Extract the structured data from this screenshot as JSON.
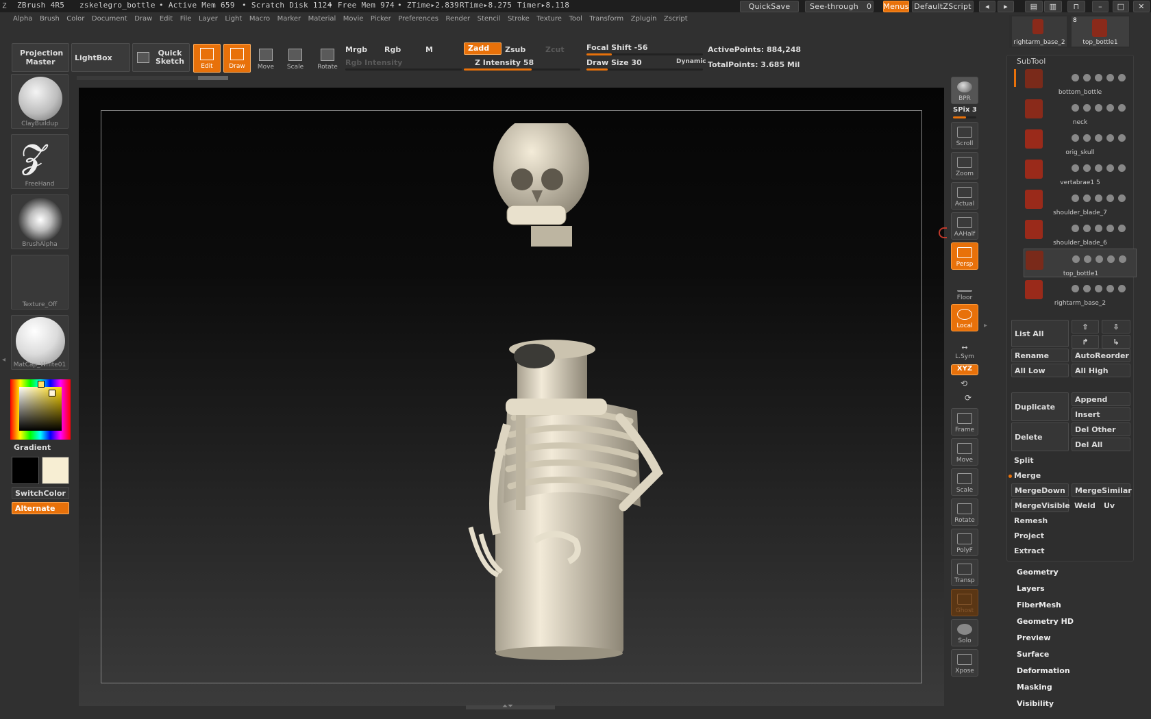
{
  "titlebar": {
    "app": "ZBrush 4R5",
    "document": "zskelegro_bottle",
    "active_mem": "• Active Mem 659",
    "scratch_disk": "• Scratch Disk 1124",
    "free_mem": "• Free Mem 974",
    "ztime": "• ZTime▸2.839",
    "rtime": "RTime▸8.275",
    "timer": "Timer▸8.118",
    "quicksave": "QuickSave",
    "see_through": "See-through",
    "see_through_value": "0",
    "menus": "Menus",
    "default_zscript": "DefaultZScript"
  },
  "menubar": [
    "Alpha",
    "Brush",
    "Color",
    "Document",
    "Draw",
    "Edit",
    "File",
    "Layer",
    "Light",
    "Macro",
    "Marker",
    "Material",
    "Movie",
    "Picker",
    "Preferences",
    "Render",
    "Stencil",
    "Stroke",
    "Texture",
    "Tool",
    "Transform",
    "Zplugin",
    "Zscript"
  ],
  "toolbar": {
    "projection_master": "Projection Master",
    "lightbox": "LightBox",
    "quick_sketch": "Quick Sketch",
    "edit": "Edit",
    "draw": "Draw",
    "move": "Move",
    "scale": "Scale",
    "rotate": "Rotate",
    "mrgb": "Mrgb",
    "rgb": "Rgb",
    "m": "M",
    "rgb_intensity": "Rgb Intensity",
    "zadd": "Zadd",
    "zsub": "Zsub",
    "zcut": "Zcut",
    "z_intensity": "Z Intensity 58",
    "focal_shift": "Focal Shift -56",
    "draw_size": "Draw Size 30",
    "dynamic": "Dynamic",
    "active_points": "ActivePoints: 884,248",
    "total_points": "TotalPoints: 3.685 Mil"
  },
  "left": {
    "brush": "ClayBuildup",
    "stroke": "FreeHand",
    "alpha": "BrushAlpha",
    "texture": "Texture_Off",
    "material": "MatCap_White01",
    "gradient": "Gradient",
    "switchcolor": "SwitchColor",
    "alternate": "Alternate"
  },
  "rightshelf": {
    "bpr": "BPR",
    "spix": "SPix 3",
    "scroll": "Scroll",
    "zoom": "Zoom",
    "actual": "Actual",
    "aahalf": "AAHalf",
    "persp": "Persp",
    "floor": "Floor",
    "local": "Local",
    "lsym": "L.Sym",
    "xyz": "XYZ",
    "frame": "Frame",
    "move": "Move",
    "scale": "Scale",
    "rotate": "Rotate",
    "polyf": "PolyF",
    "transp": "Transp",
    "ghost": "Ghost",
    "solo": "Solo",
    "xpose": "Xpose"
  },
  "tool_thumbs": {
    "left": "rightarm_base_2",
    "right": "top_bottle1",
    "count": "8"
  },
  "subtool": {
    "title": "SubTool",
    "items": [
      {
        "name": "bottom_bottle",
        "color": "#7a2a1a"
      },
      {
        "name": "neck",
        "color": "#8a2a1a"
      },
      {
        "name": "orig_skull",
        "color": "#9a2a1a"
      },
      {
        "name": "vertabrae1 5",
        "color": "#9a2a1a"
      },
      {
        "name": "shoulder_blade_7",
        "color": "#9a2a1a"
      },
      {
        "name": "shoulder_blade_6",
        "color": "#9a2a1a"
      },
      {
        "name": "top_bottle1",
        "color": "#7a2a1a"
      },
      {
        "name": "rightarm_base_2",
        "color": "#9a2a1a"
      }
    ],
    "list_all": "List All",
    "rename": "Rename",
    "autoreorder": "AutoReorder",
    "all_low": "All Low",
    "all_high": "All High",
    "duplicate": "Duplicate",
    "append": "Append",
    "insert": "Insert",
    "delete": "Delete",
    "del_other": "Del Other",
    "del_all": "Del All",
    "split": "Split",
    "merge": "Merge",
    "mergedown": "MergeDown",
    "mergesimilar": "MergeSimilar",
    "mergevisible": "MergeVisible",
    "weld": "Weld",
    "uv": "Uv",
    "remesh": "Remesh",
    "project": "Project",
    "extract": "Extract"
  },
  "tool_sections": [
    "Geometry",
    "Layers",
    "FiberMesh",
    "Geometry HD",
    "Preview",
    "Surface",
    "Deformation",
    "Masking",
    "Visibility"
  ],
  "colors": {
    "accent": "#e8710a",
    "background": "#303030",
    "model": "#e2dac7"
  }
}
